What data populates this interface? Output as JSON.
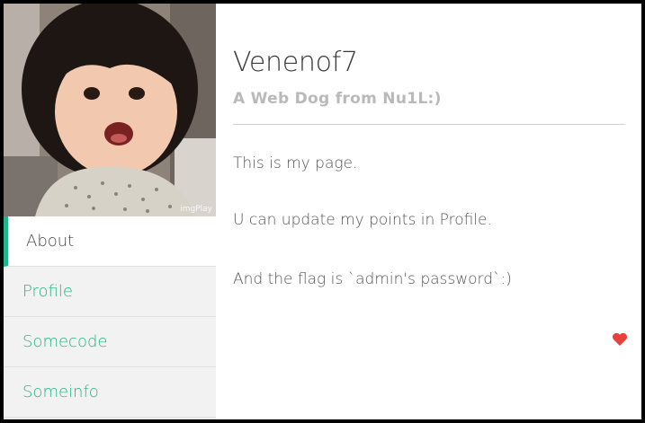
{
  "sidebar": {
    "photo_watermark": "imgPlay",
    "items": [
      {
        "label": "About",
        "active": true
      },
      {
        "label": "Profile",
        "active": false
      },
      {
        "label": "Somecode",
        "active": false
      },
      {
        "label": "Someinfo",
        "active": false
      }
    ]
  },
  "profile": {
    "name": "Venenof7",
    "subtitle": "A Web Dog from Nu1L:)"
  },
  "content": {
    "paragraphs": [
      "This is my page.",
      "U can update my points in Profile.",
      "And the flag is `admin's password`:)"
    ]
  },
  "colors": {
    "accent": "#1fb58a",
    "heart": "#e8413c"
  },
  "icons": {
    "like": "heart-icon"
  }
}
